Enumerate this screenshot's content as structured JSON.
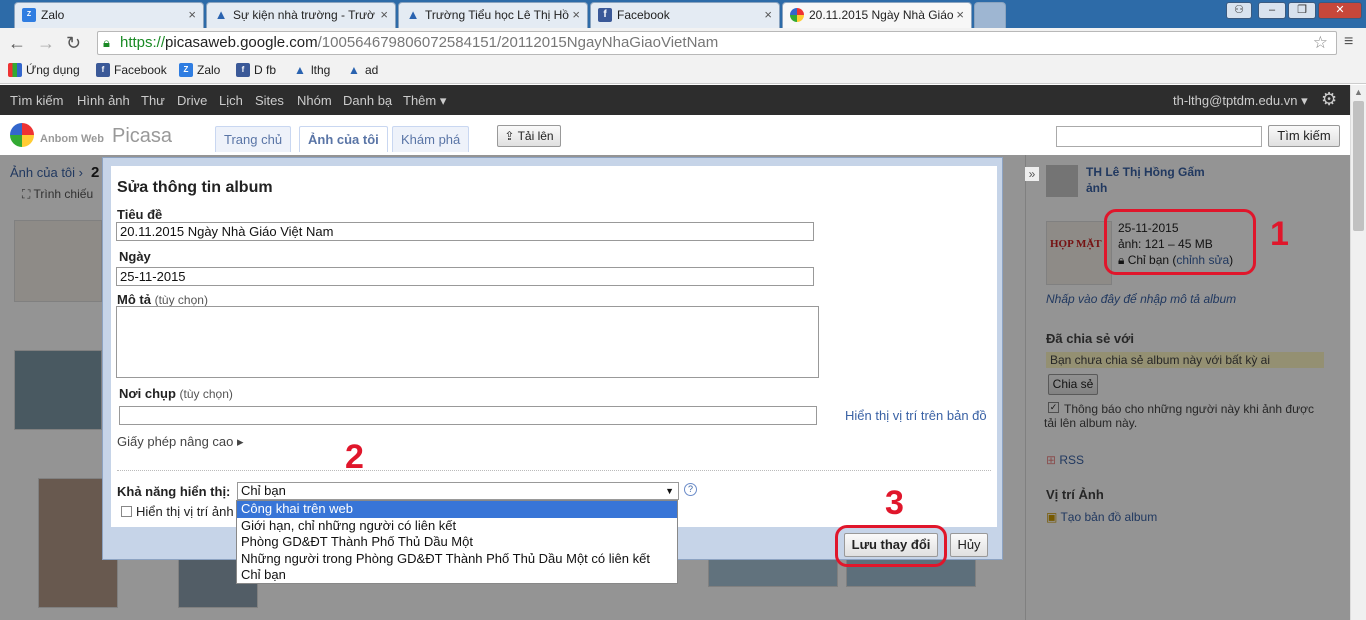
{
  "browser": {
    "tabs": [
      {
        "label": "Zalo",
        "icon": "zalo-icon"
      },
      {
        "label": "Sự kiện nhà trường - Trườ",
        "icon": "drop-icon"
      },
      {
        "label": "Trường Tiểu học Lê Thị Hồ",
        "icon": "drop-icon"
      },
      {
        "label": "Facebook",
        "icon": "facebook-icon"
      },
      {
        "label": "20.11.2015 Ngày Nhà Giáo",
        "icon": "picasa-icon"
      }
    ],
    "url_secure": "https://",
    "url_domain": "picasaweb.google.com",
    "url_path": "/100564679806072584151/20112015NgayNhaGiaoVietNam",
    "bookmarks": [
      "Ứng dụng",
      "Facebook",
      "Zalo",
      "D fb",
      "lthg",
      "ad"
    ]
  },
  "google_bar": {
    "items": [
      "Tìm kiếm",
      "Hình ảnh",
      "Thư",
      "Drive",
      "Lịch",
      "Sites",
      "Nhóm",
      "Danh bạ",
      "Thêm ▾"
    ],
    "account": "th-lthg@tptdm.edu.vn ▾"
  },
  "picasa": {
    "logo_small": "Anbom Web",
    "logo_big": "Picasa",
    "tabs": [
      "Trang chủ",
      "Ảnh của tôi",
      "Khám phá"
    ],
    "upload": "Tải lên",
    "search_button": "Tìm kiếm",
    "breadcrumb": "Ảnh của tôi ›",
    "breadcrumb_tail": "2",
    "slideshow": "Trình chiếu"
  },
  "sidebar": {
    "owner": "TH Lê Thị Hồng Gấm",
    "owner_sub": "ảnh",
    "date": "25-11-2015",
    "size": "ảnh: 121 – 45 MB",
    "visibility_prefix": "Chỉ bạn (",
    "visibility_link": "chỉnh sửa",
    "visibility_suffix": ")",
    "desc_link": "Nhấp vào đây để nhập mô tả album",
    "shared_title": "Đã chia sẻ với",
    "shared_note": "Bạn chưa chia sẻ album này với bất kỳ ai",
    "share_button": "Chia sẻ",
    "notify": "Thông báo cho những người này khi ảnh được tải lên album này.",
    "rss": "RSS",
    "location_title": "Vị trí Ảnh",
    "map_link": "Tạo bản đồ album",
    "thumb_title": "HỌP MẶT"
  },
  "dialog": {
    "title": "Sửa thông tin album",
    "title_label": "Tiêu đề",
    "title_value": "20.11.2015 Ngày Nhà Giáo Việt Nam",
    "date_label": "Ngày",
    "date_value": "25-11-2015",
    "desc_label": "Mô tả",
    "desc_optional": "(tùy chọn)",
    "place_label": "Nơi chụp",
    "place_optional": "(tùy chọn)",
    "map_link": "Hiển thị vị trí trên bản đồ",
    "license_link": "Giấy phép nâng cao ▸",
    "visibility_label": "Khả năng hiển thị:",
    "visibility_value": "Chỉ bạn",
    "show_location": "Hiển thị vị trí ảnh",
    "save_button": "Lưu thay đổi",
    "cancel_button": "Hủy",
    "options": [
      "Công khai trên web",
      "Giới hạn, chỉ những người có liên kết",
      "Phòng GD&ĐT Thành Phố Thủ Dầu Một",
      "Những người trong Phòng GD&ĐT Thành Phố Thủ Dầu Một có liên kết",
      "Chỉ bạn"
    ],
    "highlighted_option": 0
  },
  "annotations": [
    "1",
    "2",
    "3"
  ],
  "colors": {
    "annotation": "#e0162b",
    "link": "#3a62a5",
    "selected": "#3875d7"
  }
}
